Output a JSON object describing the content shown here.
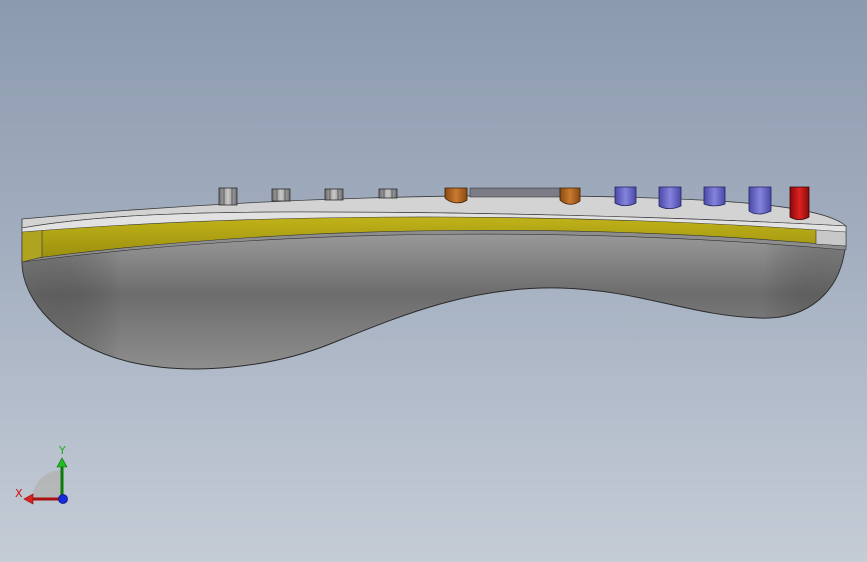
{
  "viewport": {
    "background_top": "#8c9aae",
    "background_bottom": "#c5ccd6"
  },
  "model": {
    "body_color": "#7a7a7a",
    "stripe_color": "#b3a514",
    "top_face_color": "#d4d4d4",
    "pins": [
      {
        "kind": "gray-pin",
        "color": "#a9a9a9"
      },
      {
        "kind": "gray-pin",
        "color": "#a9a9a9"
      },
      {
        "kind": "gray-pin",
        "color": "#a9a9a9"
      },
      {
        "kind": "gray-pin",
        "color": "#a9a9a9"
      },
      {
        "kind": "orange-pin",
        "color": "#b8671e"
      },
      {
        "kind": "orange-pin",
        "color": "#b8671e"
      },
      {
        "kind": "blue-pin",
        "color": "#6d6cc9"
      },
      {
        "kind": "blue-pin",
        "color": "#6d6cc9"
      },
      {
        "kind": "blue-pin",
        "color": "#6d6cc9"
      },
      {
        "kind": "blue-pin",
        "color": "#6d6cc9"
      },
      {
        "kind": "red-pin",
        "color": "#c41616"
      }
    ]
  },
  "triad": {
    "x_label": "X",
    "y_label": "Y",
    "x_color": "#cc1111",
    "y_color": "#11aa11",
    "z_color": "#1122dd"
  }
}
